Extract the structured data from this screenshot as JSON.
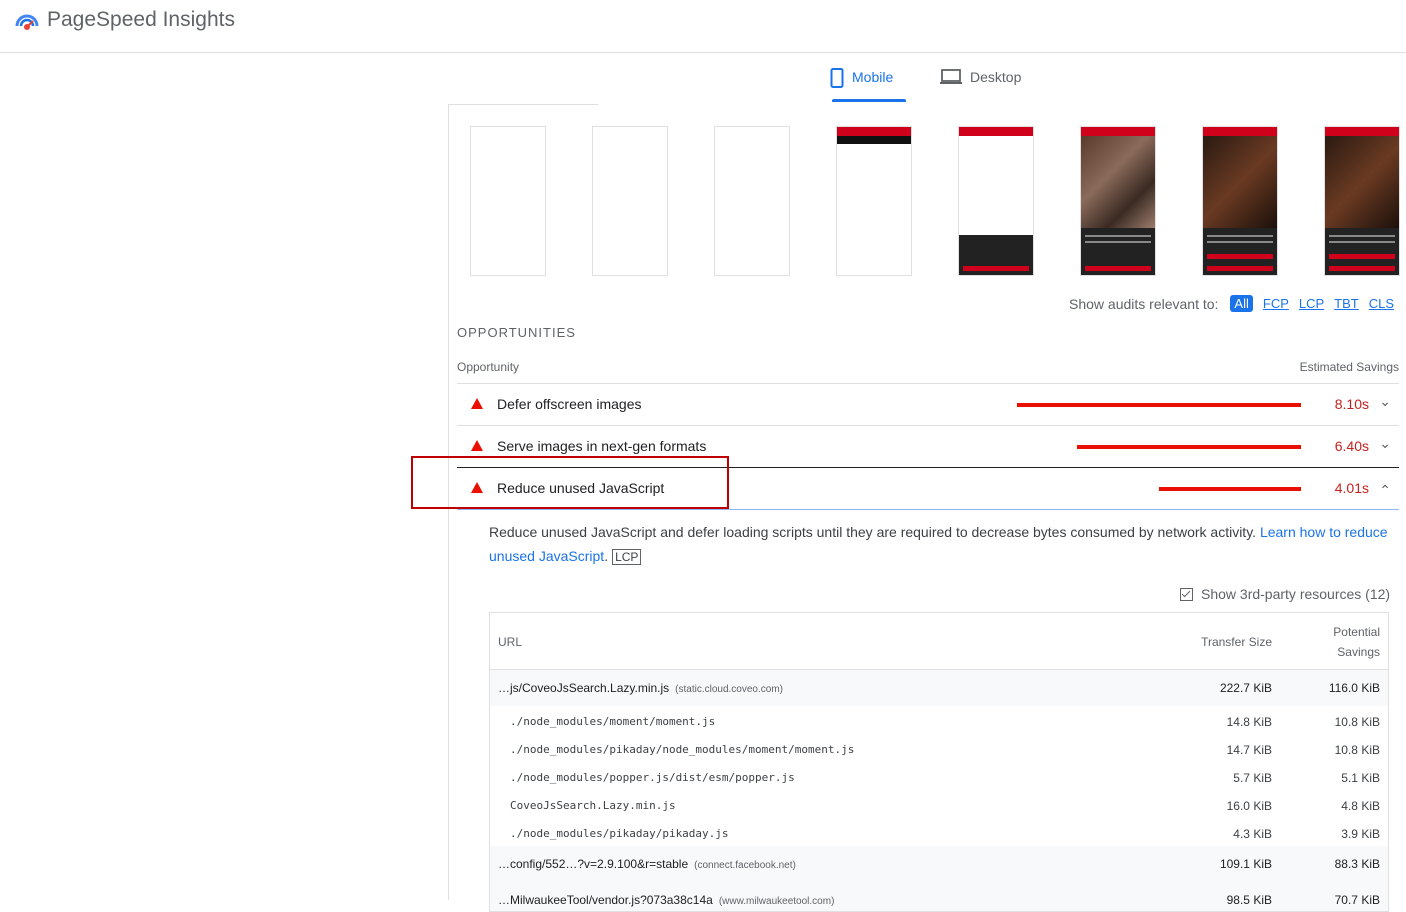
{
  "app": {
    "title": "PageSpeed Insights"
  },
  "tabs": [
    {
      "label": "Mobile",
      "active": true
    },
    {
      "label": "Desktop",
      "active": false
    }
  ],
  "audit_filter": {
    "label": "Show audits relevant to:",
    "chips": [
      "All",
      "FCP",
      "LCP",
      "TBT",
      "CLS"
    ],
    "active": "All"
  },
  "opportunities": {
    "section_title": "OPPORTUNITIES",
    "col_opportunity": "Opportunity",
    "col_savings": "Estimated Savings",
    "items": [
      {
        "title": "Defer offscreen images",
        "savings": "8.10s",
        "fraction": 1.0
      },
      {
        "title": "Serve images in next-gen formats",
        "savings": "6.40s",
        "fraction": 0.79
      },
      {
        "title": "Reduce unused JavaScript",
        "savings": "4.01s",
        "fraction": 0.5
      }
    ]
  },
  "detail": {
    "description": "Reduce unused JavaScript and defer loading scripts until they are required to decrease bytes consumed by network activity. ",
    "link": "Learn how to reduce unused JavaScript",
    "link_suffix": ".",
    "tag": "LCP",
    "third_party_label": "Show 3rd-party resources (12)",
    "table": {
      "col_url": "URL",
      "col_transfer": "Transfer Size",
      "col_potential_1": "Potential",
      "col_potential_2": "Savings",
      "rows": [
        {
          "type": "main",
          "url": "…js/CoveoJsSearch.Lazy.min.js",
          "host": "(static.cloud.coveo.com)",
          "transfer": "222.7 KiB",
          "savings": "116.0 KiB"
        },
        {
          "type": "sub",
          "url": "./node_modules/moment/moment.js",
          "transfer": "14.8 KiB",
          "savings": "10.8 KiB"
        },
        {
          "type": "sub",
          "url": "./node_modules/pikaday/node_modules/moment/moment.js",
          "transfer": "14.7 KiB",
          "savings": "10.8 KiB"
        },
        {
          "type": "sub",
          "url": "./node_modules/popper.js/dist/esm/popper.js",
          "transfer": "5.7 KiB",
          "savings": "5.1 KiB"
        },
        {
          "type": "sub",
          "url": "CoveoJsSearch.Lazy.min.js",
          "transfer": "16.0 KiB",
          "savings": "4.8 KiB"
        },
        {
          "type": "sub",
          "url": "./node_modules/pikaday/pikaday.js",
          "transfer": "4.3 KiB",
          "savings": "3.9 KiB"
        },
        {
          "type": "main",
          "url": "…config/552…?v=2.9.100&r=stable",
          "host": "(connect.facebook.net)",
          "transfer": "109.1 KiB",
          "savings": "88.3 KiB"
        },
        {
          "type": "main",
          "url": "…MilwaukeeTool/vendor.js?073a38c14a",
          "host": "(www.milwaukeetool.com)",
          "transfer": "98.5 KiB",
          "savings": "70.7 KiB"
        }
      ]
    }
  },
  "colors": {
    "accent": "#1a73e8",
    "fail": "#eb0f00",
    "highlight": "#c00000"
  }
}
